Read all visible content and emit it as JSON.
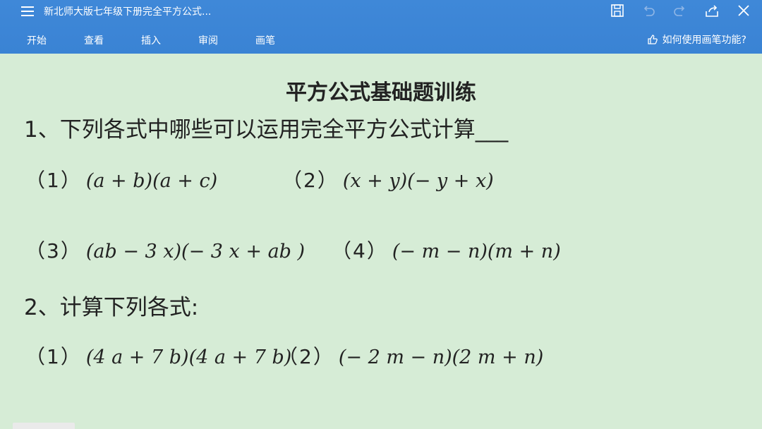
{
  "toolbar": {
    "title": "新北师大版七年级下册完全平方公式...",
    "tabs": [
      "开始",
      "查看",
      "插入",
      "审阅",
      "画笔"
    ],
    "help": "如何使用画笔功能?",
    "icons": [
      "menu-icon",
      "save-icon",
      "undo-icon",
      "redo-icon",
      "share-icon",
      "close-icon",
      "thumbs-up-icon"
    ]
  },
  "doc": {
    "heading": "平方公式基础题训练",
    "q1": "1、下列各式中哪些可以运用完全平方公式计算___",
    "q1_items": [
      {
        "num": "（1）",
        "expr": "(a + b)(a + c)"
      },
      {
        "num": "（2）",
        "expr": "(x + y)(− y + x)"
      },
      {
        "num": "（3）",
        "expr": "(ab − 3 x)(− 3 x + ab )"
      },
      {
        "num": "（4）",
        "expr": "(− m − n)(m + n)"
      }
    ],
    "q2": "2、计算下列各式:",
    "q2_items": [
      {
        "num": "（1）",
        "expr": "(4 a + 7 b)(4 a + 7 b)"
      },
      {
        "num": "（2）",
        "expr": "(− 2 m − n)(2 m + n)"
      }
    ]
  }
}
